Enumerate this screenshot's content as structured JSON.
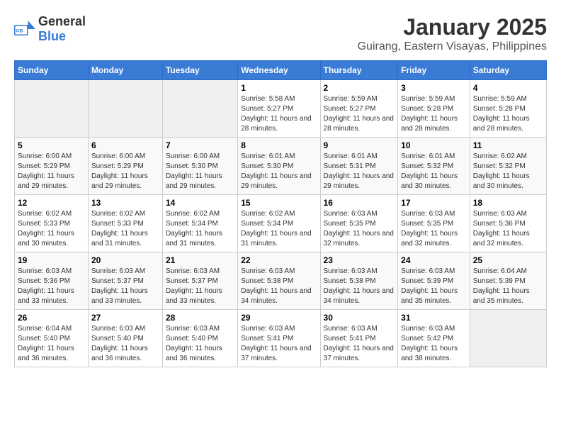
{
  "header": {
    "logo_general": "General",
    "logo_blue": "Blue",
    "title": "January 2025",
    "subtitle": "Guirang, Eastern Visayas, Philippines"
  },
  "calendar": {
    "weekdays": [
      "Sunday",
      "Monday",
      "Tuesday",
      "Wednesday",
      "Thursday",
      "Friday",
      "Saturday"
    ],
    "weeks": [
      [
        {
          "day": "",
          "sunrise": "",
          "sunset": "",
          "daylight": "",
          "empty": true
        },
        {
          "day": "",
          "sunrise": "",
          "sunset": "",
          "daylight": "",
          "empty": true
        },
        {
          "day": "",
          "sunrise": "",
          "sunset": "",
          "daylight": "",
          "empty": true
        },
        {
          "day": "1",
          "sunrise": "Sunrise: 5:58 AM",
          "sunset": "Sunset: 5:27 PM",
          "daylight": "Daylight: 11 hours and 28 minutes."
        },
        {
          "day": "2",
          "sunrise": "Sunrise: 5:59 AM",
          "sunset": "Sunset: 5:27 PM",
          "daylight": "Daylight: 11 hours and 28 minutes."
        },
        {
          "day": "3",
          "sunrise": "Sunrise: 5:59 AM",
          "sunset": "Sunset: 5:28 PM",
          "daylight": "Daylight: 11 hours and 28 minutes."
        },
        {
          "day": "4",
          "sunrise": "Sunrise: 5:59 AM",
          "sunset": "Sunset: 5:28 PM",
          "daylight": "Daylight: 11 hours and 28 minutes."
        }
      ],
      [
        {
          "day": "5",
          "sunrise": "Sunrise: 6:00 AM",
          "sunset": "Sunset: 5:29 PM",
          "daylight": "Daylight: 11 hours and 29 minutes."
        },
        {
          "day": "6",
          "sunrise": "Sunrise: 6:00 AM",
          "sunset": "Sunset: 5:29 PM",
          "daylight": "Daylight: 11 hours and 29 minutes."
        },
        {
          "day": "7",
          "sunrise": "Sunrise: 6:00 AM",
          "sunset": "Sunset: 5:30 PM",
          "daylight": "Daylight: 11 hours and 29 minutes."
        },
        {
          "day": "8",
          "sunrise": "Sunrise: 6:01 AM",
          "sunset": "Sunset: 5:30 PM",
          "daylight": "Daylight: 11 hours and 29 minutes."
        },
        {
          "day": "9",
          "sunrise": "Sunrise: 6:01 AM",
          "sunset": "Sunset: 5:31 PM",
          "daylight": "Daylight: 11 hours and 29 minutes."
        },
        {
          "day": "10",
          "sunrise": "Sunrise: 6:01 AM",
          "sunset": "Sunset: 5:32 PM",
          "daylight": "Daylight: 11 hours and 30 minutes."
        },
        {
          "day": "11",
          "sunrise": "Sunrise: 6:02 AM",
          "sunset": "Sunset: 5:32 PM",
          "daylight": "Daylight: 11 hours and 30 minutes."
        }
      ],
      [
        {
          "day": "12",
          "sunrise": "Sunrise: 6:02 AM",
          "sunset": "Sunset: 5:33 PM",
          "daylight": "Daylight: 11 hours and 30 minutes."
        },
        {
          "day": "13",
          "sunrise": "Sunrise: 6:02 AM",
          "sunset": "Sunset: 5:33 PM",
          "daylight": "Daylight: 11 hours and 31 minutes."
        },
        {
          "day": "14",
          "sunrise": "Sunrise: 6:02 AM",
          "sunset": "Sunset: 5:34 PM",
          "daylight": "Daylight: 11 hours and 31 minutes."
        },
        {
          "day": "15",
          "sunrise": "Sunrise: 6:02 AM",
          "sunset": "Sunset: 5:34 PM",
          "daylight": "Daylight: 11 hours and 31 minutes."
        },
        {
          "day": "16",
          "sunrise": "Sunrise: 6:03 AM",
          "sunset": "Sunset: 5:35 PM",
          "daylight": "Daylight: 11 hours and 32 minutes."
        },
        {
          "day": "17",
          "sunrise": "Sunrise: 6:03 AM",
          "sunset": "Sunset: 5:35 PM",
          "daylight": "Daylight: 11 hours and 32 minutes."
        },
        {
          "day": "18",
          "sunrise": "Sunrise: 6:03 AM",
          "sunset": "Sunset: 5:36 PM",
          "daylight": "Daylight: 11 hours and 32 minutes."
        }
      ],
      [
        {
          "day": "19",
          "sunrise": "Sunrise: 6:03 AM",
          "sunset": "Sunset: 5:36 PM",
          "daylight": "Daylight: 11 hours and 33 minutes."
        },
        {
          "day": "20",
          "sunrise": "Sunrise: 6:03 AM",
          "sunset": "Sunset: 5:37 PM",
          "daylight": "Daylight: 11 hours and 33 minutes."
        },
        {
          "day": "21",
          "sunrise": "Sunrise: 6:03 AM",
          "sunset": "Sunset: 5:37 PM",
          "daylight": "Daylight: 11 hours and 33 minutes."
        },
        {
          "day": "22",
          "sunrise": "Sunrise: 6:03 AM",
          "sunset": "Sunset: 5:38 PM",
          "daylight": "Daylight: 11 hours and 34 minutes."
        },
        {
          "day": "23",
          "sunrise": "Sunrise: 6:03 AM",
          "sunset": "Sunset: 5:38 PM",
          "daylight": "Daylight: 11 hours and 34 minutes."
        },
        {
          "day": "24",
          "sunrise": "Sunrise: 6:03 AM",
          "sunset": "Sunset: 5:39 PM",
          "daylight": "Daylight: 11 hours and 35 minutes."
        },
        {
          "day": "25",
          "sunrise": "Sunrise: 6:04 AM",
          "sunset": "Sunset: 5:39 PM",
          "daylight": "Daylight: 11 hours and 35 minutes."
        }
      ],
      [
        {
          "day": "26",
          "sunrise": "Sunrise: 6:04 AM",
          "sunset": "Sunset: 5:40 PM",
          "daylight": "Daylight: 11 hours and 36 minutes."
        },
        {
          "day": "27",
          "sunrise": "Sunrise: 6:03 AM",
          "sunset": "Sunset: 5:40 PM",
          "daylight": "Daylight: 11 hours and 36 minutes."
        },
        {
          "day": "28",
          "sunrise": "Sunrise: 6:03 AM",
          "sunset": "Sunset: 5:40 PM",
          "daylight": "Daylight: 11 hours and 36 minutes."
        },
        {
          "day": "29",
          "sunrise": "Sunrise: 6:03 AM",
          "sunset": "Sunset: 5:41 PM",
          "daylight": "Daylight: 11 hours and 37 minutes."
        },
        {
          "day": "30",
          "sunrise": "Sunrise: 6:03 AM",
          "sunset": "Sunset: 5:41 PM",
          "daylight": "Daylight: 11 hours and 37 minutes."
        },
        {
          "day": "31",
          "sunrise": "Sunrise: 6:03 AM",
          "sunset": "Sunset: 5:42 PM",
          "daylight": "Daylight: 11 hours and 38 minutes."
        },
        {
          "day": "",
          "sunrise": "",
          "sunset": "",
          "daylight": "",
          "empty": true
        }
      ]
    ]
  }
}
